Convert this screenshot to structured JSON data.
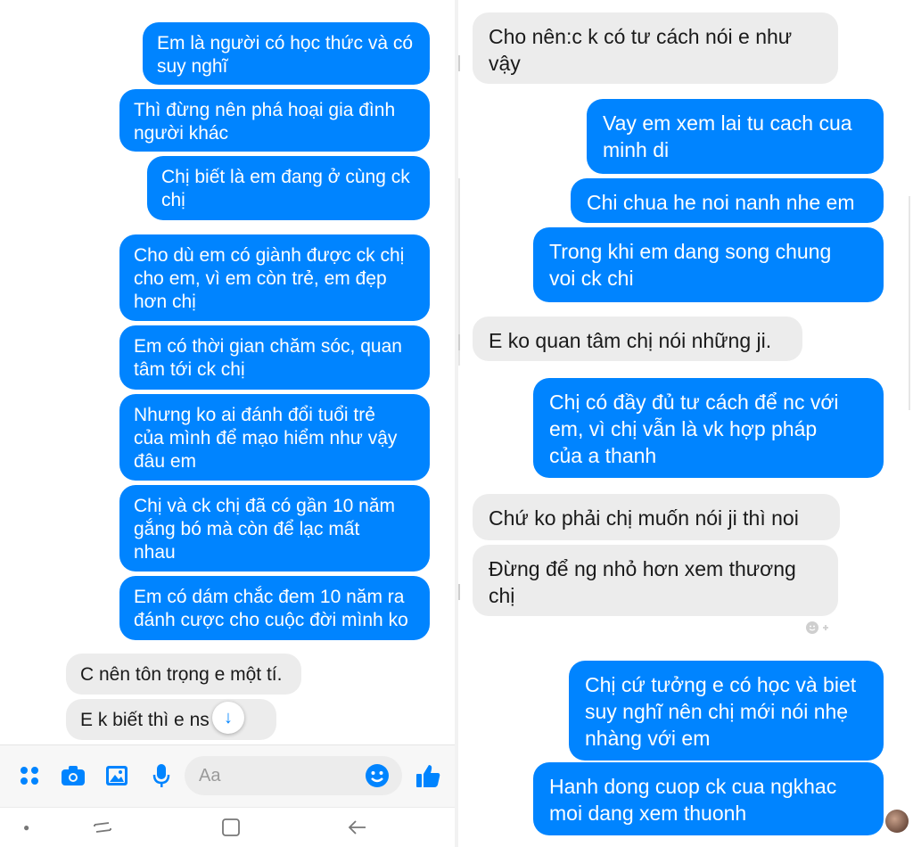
{
  "left_chat": {
    "messages": [
      {
        "dir": "out",
        "text": "Em là người có học thức và có\nsuy nghĩ"
      },
      {
        "dir": "out",
        "text": "Thì đừng nên phá hoại gia đình\nngười khác"
      },
      {
        "dir": "out",
        "text": "Chị biết là em đang ở cùng ck\nchị"
      },
      {
        "dir": "out",
        "text": "Cho dù em có giành được ck chị\ncho em, vì em còn trẻ, em đẹp\nhơn chị"
      },
      {
        "dir": "out",
        "text": "Em có thời gian chăm sóc, quan\ntâm tới ck chị"
      },
      {
        "dir": "out",
        "text": "Nhưng ko ai đánh đổi tuổi trẻ\ncủa mình để mạo hiểm như vậy\nđâu em"
      },
      {
        "dir": "out",
        "text": "Chị và ck chị đã có gần 10 năm\ngắng bó mà còn để lạc mất\nnhau"
      },
      {
        "dir": "out",
        "text": "Em có dám chắc đem 10 năm ra\nđánh cược cho cuộc đời mình ko"
      },
      {
        "dir": "in",
        "text": "C nên tôn trọng e một tí."
      },
      {
        "dir": "in",
        "text": "E k biết thì e ns      ết"
      }
    ],
    "composer": {
      "placeholder": "Aa",
      "icons": [
        "apps-icon",
        "camera-icon",
        "gallery-icon",
        "microphone-icon",
        "emoji-icon",
        "thumbs-up-icon"
      ]
    },
    "scroll_down_icon": "arrow-down-icon",
    "navbar_icons": [
      "dot-icon",
      "recent-apps-icon",
      "home-icon",
      "back-icon"
    ]
  },
  "right_chat": {
    "messages": [
      {
        "dir": "in",
        "text": "Cho nên:c k có tư cách nói e như\nvậy"
      },
      {
        "dir": "out",
        "text": "Vay em xem lai tu cach cua\nminh di"
      },
      {
        "dir": "out",
        "text": "Chi chua he noi nanh nhe em"
      },
      {
        "dir": "out",
        "text": "Trong khi em dang song chung\nvoi ck chi"
      },
      {
        "dir": "in",
        "text": "E ko quan tâm chị nói những ji."
      },
      {
        "dir": "out",
        "text": "Chị có đầy đủ tư cách để nc với\nem, vì chị vẫn là vk hợp pháp\ncủa a thanh"
      },
      {
        "dir": "in",
        "text": "Chứ ko phải chị muốn nói ji thì noi"
      },
      {
        "dir": "in",
        "text": "Đừng để ng nhỏ hơn xem thương\nchị"
      },
      {
        "dir": "out",
        "text": "Chị cứ tưởng e có học và biet\nsuy nghĩ nên chị mới nói nhẹ\nnhàng với em"
      },
      {
        "dir": "out",
        "text": "Hanh dong cuop ck cua ngkhac\nmoi dang xem thuonh"
      }
    ],
    "reaction_icon": "add-reaction-icon",
    "avatar_icon": "seen-avatar-icon"
  },
  "colors": {
    "outgoing_bubble": "#0084ff",
    "incoming_bubble": "#ececec",
    "accent": "#0084ff"
  }
}
